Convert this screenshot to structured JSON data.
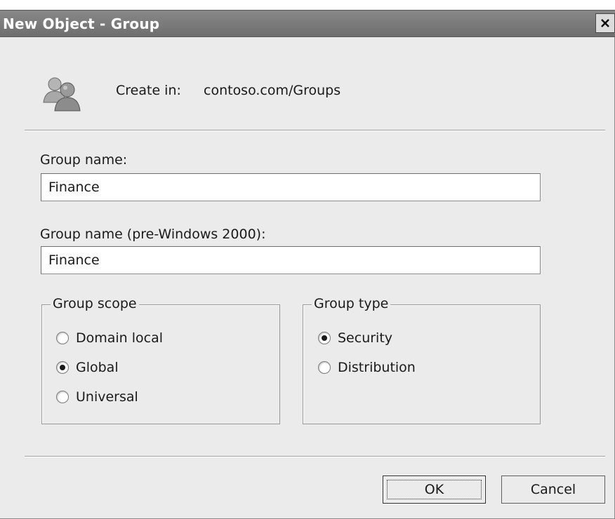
{
  "window": {
    "title": "New Object - Group"
  },
  "header": {
    "create_in_label": "Create in:",
    "create_in_value": "contoso.com/Groups",
    "icon": "group-icon"
  },
  "fields": {
    "group_name_label": "Group name:",
    "group_name_value": "Finance",
    "group_name_pre2000_label": "Group name (pre-Windows 2000):",
    "group_name_pre2000_value": "Finance"
  },
  "group_scope": {
    "legend": "Group scope",
    "options": [
      "Domain local",
      "Global",
      "Universal"
    ],
    "selected": "Global"
  },
  "group_type": {
    "legend": "Group type",
    "options": [
      "Security",
      "Distribution"
    ],
    "selected": "Security"
  },
  "buttons": {
    "ok": "OK",
    "cancel": "Cancel"
  },
  "colors": {
    "titlebar": "#7a7a7a",
    "dialog_bg": "#ebebeb"
  }
}
